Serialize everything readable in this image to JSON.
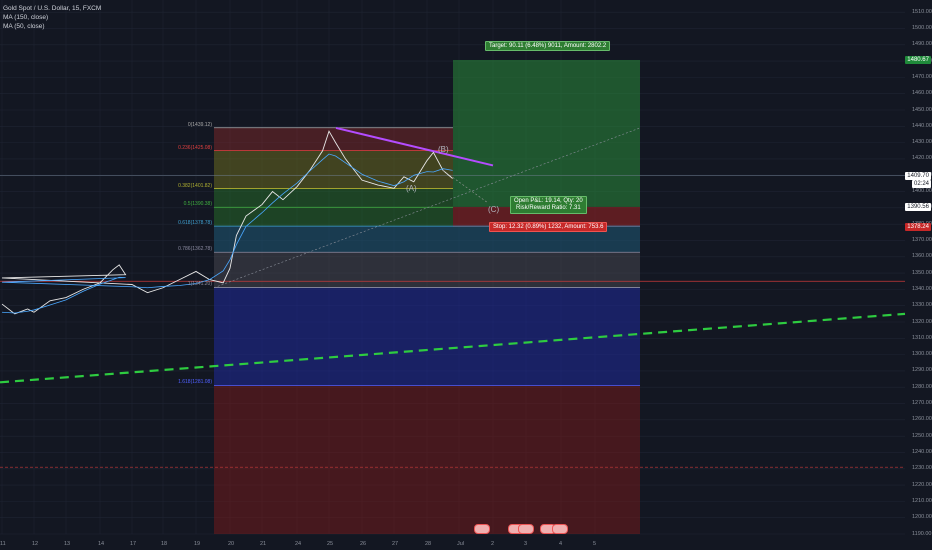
{
  "legend": {
    "symbol": "Gold Spot / U.S. Dollar, 15, FXCM",
    "ma1": "MA (150, close)",
    "ma2": "MA (50, close)"
  },
  "colors": {
    "background": "#131722",
    "ma_green_dashed": "#2ecc40",
    "purple_trend": "#b44cff",
    "target_green": "#1a7a2e",
    "stop_red": "#8a1f1f",
    "fib_blue": "#2233aa"
  },
  "chart_data": {
    "type": "line",
    "title": "Gold Spot / U.S. Dollar, 15, FXCM",
    "ylim": [
      1190,
      1515
    ],
    "y_ticks": [
      "1510.00",
      "1500.00",
      "1490.00",
      "1480.00",
      "1470.00",
      "1460.00",
      "1450.00",
      "1440.00",
      "1430.00",
      "1420.00",
      "1410.00",
      "1400.00",
      "1390.00",
      "1380.00",
      "1370.00",
      "1360.00",
      "1350.00",
      "1340.00",
      "1330.00",
      "1320.00",
      "1310.00",
      "1300.00",
      "1290.00",
      "1280.00",
      "1270.00",
      "1260.00",
      "1250.00",
      "1240.00",
      "1230.00",
      "1220.00",
      "1210.00",
      "1200.00",
      "1190.00"
    ],
    "x_ticks": [
      "11",
      "12",
      "13",
      "14",
      "17",
      "18",
      "19",
      "20",
      "21",
      "24",
      "25",
      "26",
      "27",
      "28",
      "Jul",
      "2",
      "3",
      "4",
      "5"
    ],
    "price_key": [
      [
        11,
        1331
      ],
      [
        11.4,
        1325
      ],
      [
        11.8,
        1328
      ],
      [
        12,
        1326
      ],
      [
        12.5,
        1333
      ],
      [
        13,
        1335
      ],
      [
        13.5,
        1340
      ],
      [
        14,
        1344
      ],
      [
        14.4,
        1352
      ],
      [
        14.6,
        1355
      ],
      [
        14.8,
        1349
      ],
      [
        15,
        1347
      ],
      [
        17,
        1343
      ],
      [
        17.5,
        1338
      ],
      [
        18,
        1341
      ],
      [
        18.5,
        1346
      ],
      [
        19,
        1351
      ],
      [
        19.4,
        1346
      ],
      [
        19.8,
        1344
      ],
      [
        20,
        1353
      ],
      [
        20.2,
        1373
      ],
      [
        20.5,
        1385
      ],
      [
        21,
        1392
      ],
      [
        21.3,
        1400
      ],
      [
        21.6,
        1395
      ],
      [
        24,
        1403
      ],
      [
        24.4,
        1413
      ],
      [
        24.8,
        1425
      ],
      [
        25,
        1437
      ],
      [
        25.2,
        1430
      ],
      [
        25.5,
        1420
      ],
      [
        26,
        1407
      ],
      [
        26.5,
        1404
      ],
      [
        27,
        1402
      ],
      [
        27.3,
        1409
      ],
      [
        27.6,
        1406
      ],
      [
        28,
        1419
      ],
      [
        28.2,
        1424
      ],
      [
        28.5,
        1413
      ],
      [
        28.8,
        1408
      ]
    ],
    "ma_dashed": {
      "from": [
        11,
        1283
      ],
      "to": [
        5.9,
        1325
      ]
    },
    "fib_levels": [
      {
        "ratio": "0(1439.12)",
        "price": 1439.12
      },
      {
        "ratio": "0.236(1425.08)",
        "price": 1425.08
      },
      {
        "ratio": "0.382(1401.82)",
        "price": 1401.82
      },
      {
        "ratio": "0.5(1390.38)",
        "price": 1390.38
      },
      {
        "ratio": "0.618(1378.78)",
        "price": 1378.78
      },
      {
        "ratio": "0.786(1362.78)",
        "price": 1362.78
      },
      {
        "ratio": "1(1341.20)",
        "price": 1341.2
      },
      {
        "ratio": "1.618(1281.08)",
        "price": 1281.08
      }
    ],
    "position": {
      "target": "Target: 90.11 (6.48%) 9011, Amount: 2802.2",
      "open": "Open P&L: 19.14, Qty: 20",
      "ratio": "Risk/Reward Ratio: 7.31",
      "stop": "Stop: 12.32 (0.89%) 1232, Amount: 753.6"
    },
    "waves": [
      "(A)",
      "(B)",
      "(C)"
    ],
    "price_labels": [
      {
        "text": "1480.67",
        "color": "#1f8a3a",
        "price": 1480.67
      },
      {
        "text": "1409.70",
        "color": "#ffffff",
        "price": 1409.7
      },
      {
        "text": "02:24",
        "color": "#ffffff",
        "price": 1404.6
      },
      {
        "text": "1390.56",
        "color": "#ffffff",
        "price": 1390.56
      },
      {
        "text": "1378.24",
        "color": "#c62828",
        "price": 1378.24
      }
    ],
    "grid": true
  }
}
